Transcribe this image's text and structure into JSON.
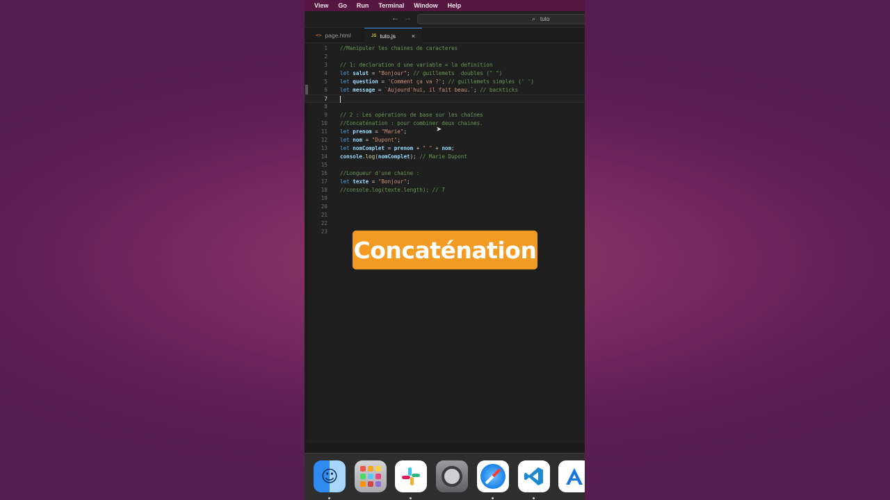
{
  "menu": [
    "View",
    "Go",
    "Run",
    "Terminal",
    "Window",
    "Help"
  ],
  "titlebar": {
    "back": "←",
    "forward": "→",
    "search_text": "tuto"
  },
  "tabs": [
    {
      "label": "page.html",
      "icon": "html-file-icon"
    },
    {
      "label": "tuto.js",
      "icon": "js-file-icon",
      "close": "×",
      "active": true
    }
  ],
  "editor": {
    "active_line": 7,
    "lines": [
      {
        "n": "1",
        "segs": [
          [
            "cm",
            "//Manipuler les chaines de caracteres"
          ]
        ]
      },
      {
        "n": "2",
        "segs": []
      },
      {
        "n": "3",
        "segs": [
          [
            "cm",
            "// 1: declaration d une variable = la definition"
          ]
        ]
      },
      {
        "n": "4",
        "segs": [
          [
            "kw",
            "let "
          ],
          [
            "var",
            "salut"
          ],
          [
            "",
            " = "
          ],
          [
            "str",
            "\"Bonjour\""
          ],
          [
            "",
            "; "
          ],
          [
            "cm",
            "// guillemets  doubles (\" \")"
          ]
        ]
      },
      {
        "n": "5",
        "segs": [
          [
            "kw",
            "let "
          ],
          [
            "var",
            "question"
          ],
          [
            "",
            " = "
          ],
          [
            "str",
            "'Comment ça va ?'"
          ],
          [
            "",
            "; "
          ],
          [
            "cm",
            "// guillemets simples (' ')"
          ]
        ]
      },
      {
        "n": "6",
        "segs": [
          [
            "kw",
            "let "
          ],
          [
            "var",
            "message"
          ],
          [
            "",
            " = "
          ],
          [
            "str",
            "`Aujourd'hui, il fait beau.`"
          ],
          [
            "",
            "; "
          ],
          [
            "cm",
            "// backticks"
          ]
        ]
      },
      {
        "n": "7",
        "segs": []
      },
      {
        "n": "8",
        "segs": []
      },
      {
        "n": "9",
        "segs": [
          [
            "cm",
            "// 2 : Les opérations de base sur les chaînes"
          ]
        ]
      },
      {
        "n": "10",
        "segs": [
          [
            "cm",
            "//Concaténation : pour combiner deux chaines."
          ]
        ]
      },
      {
        "n": "11",
        "segs": [
          [
            "kw",
            "let "
          ],
          [
            "var",
            "prenom"
          ],
          [
            "",
            " = "
          ],
          [
            "str",
            "\"Marie\""
          ],
          [
            "",
            ";"
          ]
        ]
      },
      {
        "n": "12",
        "segs": [
          [
            "kw",
            "let "
          ],
          [
            "var",
            "nom"
          ],
          [
            "",
            " = "
          ],
          [
            "str",
            "\"Dupont\""
          ],
          [
            "",
            ";"
          ]
        ]
      },
      {
        "n": "13",
        "segs": [
          [
            "kw",
            "let "
          ],
          [
            "var",
            "nomComplet"
          ],
          [
            "",
            " = "
          ],
          [
            "var",
            "prenom"
          ],
          [
            "",
            " + "
          ],
          [
            "str",
            "\" \""
          ],
          [
            "",
            " + "
          ],
          [
            "var",
            "nom"
          ],
          [
            "",
            ";"
          ]
        ]
      },
      {
        "n": "14",
        "segs": [
          [
            "var",
            "console"
          ],
          [
            "",
            "."
          ],
          [
            "fn",
            "log"
          ],
          [
            "",
            "("
          ],
          [
            "var",
            "nomComplet"
          ],
          [
            "",
            "); "
          ],
          [
            "cm",
            "// Marie Dupont"
          ]
        ]
      },
      {
        "n": "15",
        "segs": []
      },
      {
        "n": "16",
        "segs": [
          [
            "cm",
            "//Longueur d'une chaine :"
          ]
        ]
      },
      {
        "n": "17",
        "segs": [
          [
            "kw",
            "let "
          ],
          [
            "var",
            "texte"
          ],
          [
            "",
            " = "
          ],
          [
            "str",
            "\"Bonjour\""
          ],
          [
            "",
            ";"
          ]
        ]
      },
      {
        "n": "18",
        "segs": [
          [
            "cm",
            "//console.log(texte.length); // 7"
          ]
        ]
      },
      {
        "n": "19",
        "segs": []
      },
      {
        "n": "20",
        "segs": []
      },
      {
        "n": "21",
        "segs": []
      },
      {
        "n": "22",
        "segs": []
      },
      {
        "n": "23",
        "segs": []
      }
    ]
  },
  "overlay": {
    "text": "Concaténation",
    "color": "#f29a21"
  },
  "dock": {
    "apps": [
      "finder-icon",
      "launchpad-icon",
      "slack-icon",
      "system-settings-icon",
      "safari-icon",
      "vscode-icon",
      "xcode-icon"
    ]
  },
  "colors": {
    "background": "#6b2260",
    "menubar": "#55163f",
    "editor": "#1f1f1f",
    "accent": "#3c8ee6"
  }
}
